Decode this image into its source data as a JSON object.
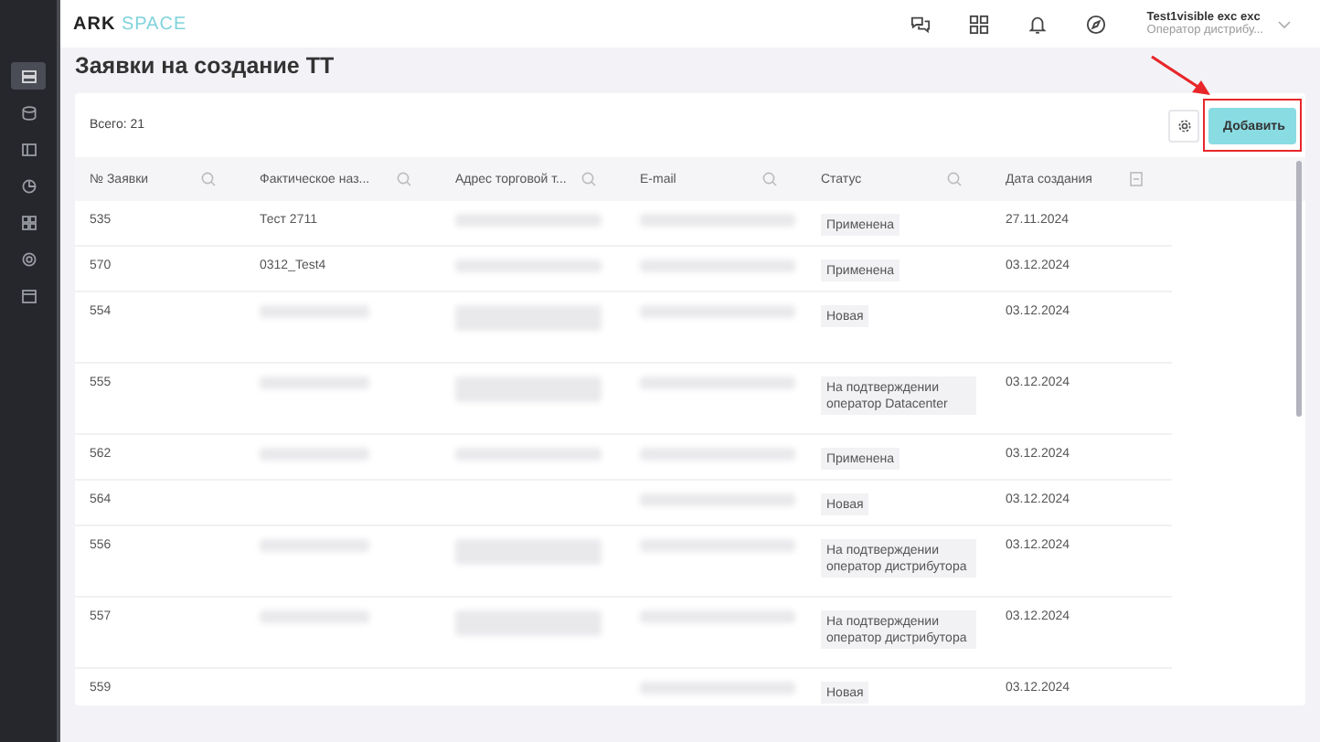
{
  "logo": {
    "strong": "ARK",
    "light": "SPACE"
  },
  "sidebar": {
    "items": [
      {
        "selected": true
      },
      {
        "selected": false
      },
      {
        "selected": false
      },
      {
        "selected": false
      },
      {
        "selected": false
      },
      {
        "selected": false
      },
      {
        "selected": false
      }
    ]
  },
  "header": {
    "user_name": "Test1visible exc exc",
    "user_role": "Оператор дистрибу..."
  },
  "page_title": "Заявки на создание ТТ",
  "total": "Всего: 21",
  "add_button": {
    "label": "Добавить",
    "highlighted": true
  },
  "table": {
    "columns": [
      {
        "label": "№ Заявки",
        "kind": "search"
      },
      {
        "label": "Фактическое наз...",
        "kind": "search"
      },
      {
        "label": "Адрес торговой т...",
        "kind": "search"
      },
      {
        "label": "E-mail",
        "kind": "search"
      },
      {
        "label": "Статус",
        "kind": "search"
      },
      {
        "label": "Дата создания",
        "kind": "date"
      }
    ],
    "rows": [
      {
        "kind": "single",
        "number": "535",
        "name": "Тест 2711",
        "name_redacted": false,
        "address_redacted": true,
        "email_redacted": true,
        "status": "Применена",
        "date": "27.11.2024"
      },
      {
        "kind": "single",
        "number": "570",
        "name": "0312_Test4",
        "name_redacted": false,
        "address_redacted": true,
        "email_redacted": true,
        "status": "Применена",
        "date": "03.12.2024"
      },
      {
        "kind": "double",
        "number": "554",
        "name_redacted": true,
        "address_redacted": true,
        "email_redacted": true,
        "status": "Новая",
        "date": "03.12.2024"
      },
      {
        "kind": "double",
        "number": "555",
        "name_redacted": true,
        "address_redacted": true,
        "email_redacted": true,
        "status": "На подтверждении оператор Datacenter",
        "date": "03.12.2024"
      },
      {
        "kind": "single",
        "number": "562",
        "name_redacted": true,
        "address_redacted": true,
        "email_redacted": true,
        "status": "Применена",
        "date": "03.12.2024"
      },
      {
        "kind": "single",
        "number": "564",
        "name_redacted": false,
        "address_redacted": false,
        "email_redacted": true,
        "status": "Новая",
        "date": "03.12.2024"
      },
      {
        "kind": "double",
        "number": "556",
        "name_redacted": true,
        "address_redacted": true,
        "email_redacted": true,
        "status": "На подтверждении оператор дистрибутора",
        "date": "03.12.2024"
      },
      {
        "kind": "double",
        "number": "557",
        "name_redacted": true,
        "address_redacted": true,
        "email_redacted": true,
        "status": "На подтверждении оператор дистрибутора",
        "date": "03.12.2024"
      },
      {
        "kind": "single",
        "number": "559",
        "name_redacted": false,
        "address_redacted": false,
        "email_redacted": true,
        "status": "Новая",
        "date": "03.12.2024"
      }
    ]
  }
}
